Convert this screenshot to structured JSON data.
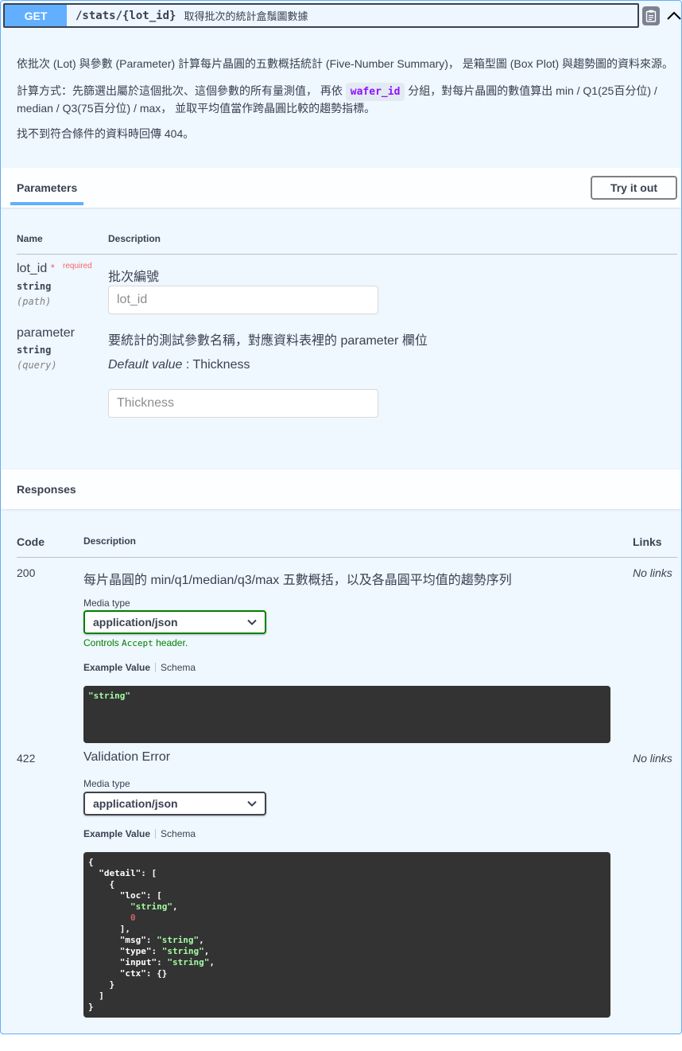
{
  "endpoint": {
    "method": "GET",
    "path": "/stats/{lot_id}",
    "summary": "取得批次的統計盒鬚圖數據"
  },
  "description": {
    "p1": "依批次 (Lot) 與參數 (Parameter) 計算每片晶圓的五數概括統計 (Five-Number Summary)， 是箱型圖 (Box Plot) 與趨勢圖的資料來源。",
    "p2_before": "計算方式：先篩選出屬於這個批次、這個參數的所有量測值， 再依",
    "p2_code": "wafer_id",
    "p2_after": "分組，對每片晶圓的數值算出 min / Q1(25百分位) /",
    "p2_line2": "median / Q3(75百分位) / max， 並取平均值當作跨晶圓比較的趨勢指標。",
    "p3": "找不到符合條件的資料時回傳 404。"
  },
  "parameters_section": {
    "title": "Parameters",
    "try_button": "Try it out",
    "col_name": "Name",
    "col_description": "Description",
    "params": [
      {
        "name": "lot_id",
        "required_star": "*",
        "required_label": "required",
        "type": "string",
        "in": "(path)",
        "description": "批次編號",
        "placeholder": "lot_id"
      },
      {
        "name": "parameter",
        "type": "string",
        "in": "(query)",
        "description": "要統計的測試參數名稱，對應資料表裡的 parameter 欄位",
        "default_label": "Default value",
        "default_sep": " : ",
        "default_value": "Thickness",
        "placeholder": "Thickness"
      }
    ]
  },
  "responses_section": {
    "title": "Responses",
    "col_code": "Code",
    "col_description": "Description",
    "col_links": "Links",
    "responses": [
      {
        "code": "200",
        "description": "每片晶圓的 min/q1/median/q3/max 五數概括，以及各晶圓平均值的趨勢序列",
        "links": "No links",
        "media_type_label": "Media type",
        "media_type": "application/json",
        "controls_before": "Controls ",
        "controls_code": "Accept",
        "controls_after": " header.",
        "example_tab": "Example Value",
        "schema_tab": "Schema",
        "example": "\"string\""
      },
      {
        "code": "422",
        "description": "Validation Error",
        "links": "No links",
        "media_type_label": "Media type",
        "media_type": "application/json",
        "example_tab": "Example Value",
        "schema_tab": "Schema"
      }
    ]
  },
  "icons": {
    "copy": "clipboard-icon",
    "collapse": "chevron-up-icon",
    "dropdown": "chevron-down-icon"
  },
  "colors": {
    "get_method": "#61affe",
    "required": "#ff0000",
    "green_border": "#008000",
    "code_bg": "#333333",
    "string_token": "#a2fca2"
  }
}
